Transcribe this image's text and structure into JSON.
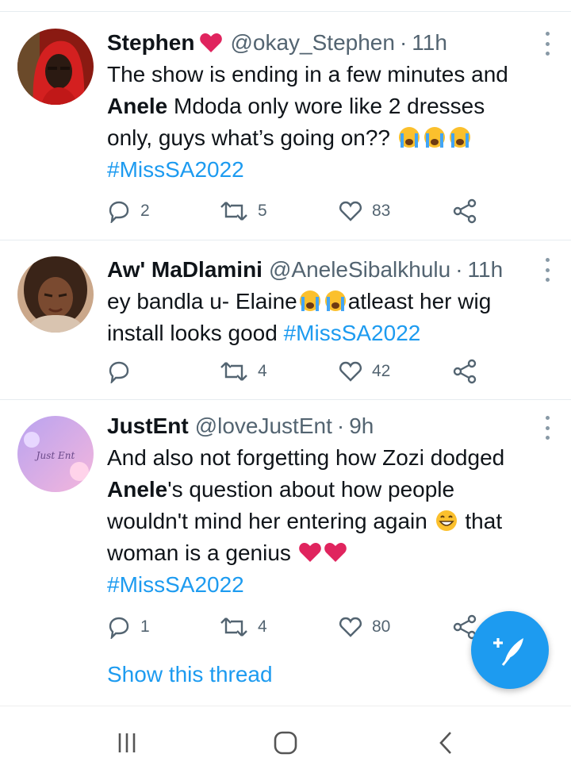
{
  "tweets": [
    {
      "display_name": "Stephen",
      "name_emoji": "red-heart",
      "handle": "@okay_Stephen",
      "time": "11h",
      "body_parts": {
        "l1": "The show is ending in a few minutes and",
        "l2_bold": "Anele",
        "l2_rest": " Mdoda only wore like 2 dresses",
        "l3": "only, guys what’s going on?? ",
        "hashtag": "#MissSA2022"
      },
      "replies": "2",
      "retweets": "5",
      "likes": "83"
    },
    {
      "display_name": "Aw' MaDlamini",
      "handle": "@AneleSibalkhulu",
      "time": "11h",
      "body_parts": {
        "l1a": "ey bandla u- Elaine",
        "l1b": "atleast her wig",
        "l2": "install looks good ",
        "hashtag": "#MissSA2022"
      },
      "replies": "",
      "retweets": "4",
      "likes": "42"
    },
    {
      "display_name": "JustEnt",
      "handle": "@loveJustEnt",
      "time": "9h",
      "avatar_text": "Just Ent",
      "body_parts": {
        "l1": "And also not forgetting how Zozi dodged",
        "l2_bold": "Anele",
        "l2_rest": "'s question about how people",
        "l3a": "wouldn't mind her entering again ",
        "l3b": " that",
        "l4": "woman is a genius ",
        "hashtag": "#MissSA2022"
      },
      "replies": "1",
      "retweets": "4",
      "likes": "80",
      "show_thread": "Show this thread"
    }
  ],
  "separator_dot": "·",
  "colors": {
    "accent": "#1d9bf0",
    "heart": "#e0245e",
    "muted": "#536471"
  },
  "icons": [
    "reply-icon",
    "retweet-icon",
    "like-icon",
    "share-icon",
    "more-icon",
    "compose-icon",
    "recent-apps-icon",
    "home-icon",
    "back-icon"
  ]
}
